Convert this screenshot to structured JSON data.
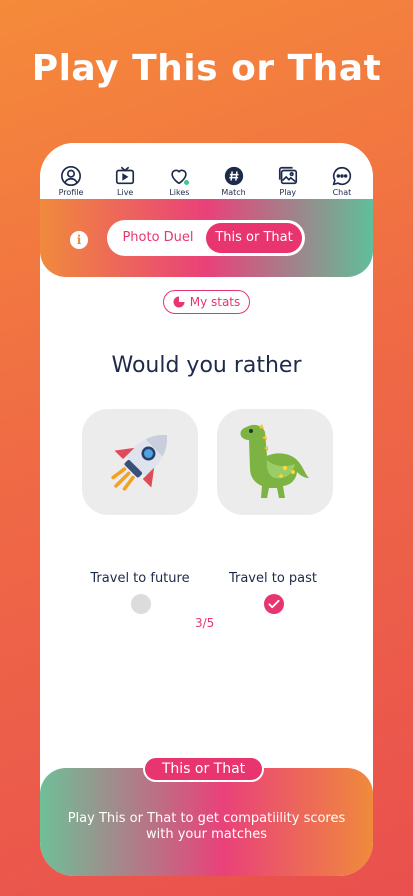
{
  "headline": "Play This or That",
  "tabs": [
    {
      "label": "Profile",
      "icon": "profile-icon"
    },
    {
      "label": "Live",
      "icon": "live-icon"
    },
    {
      "label": "Likes",
      "icon": "heart-icon"
    },
    {
      "label": "Match",
      "icon": "match-icon"
    },
    {
      "label": "Play",
      "icon": "photos-icon",
      "active": true
    },
    {
      "label": "Chat",
      "icon": "chat-icon"
    }
  ],
  "mode_switch": {
    "option_1": "Photo Duel",
    "option_2": "This or That",
    "selected": "This or That"
  },
  "stats_button": "My stats",
  "question": "Would you rather",
  "choices": [
    {
      "label": "Travel to future",
      "image": "rocket",
      "selected": false
    },
    {
      "label": "Travel to past",
      "image": "dinosaur",
      "selected": true
    }
  ],
  "progress": "3/5",
  "bottom": {
    "pill": "This or That",
    "text": "Play This or That to get compatiility scores with your matches"
  },
  "colors": {
    "accent": "#e8356f",
    "navy": "#1e2a4a",
    "green": "#5fbf9a",
    "orange": "#f08a3c"
  }
}
